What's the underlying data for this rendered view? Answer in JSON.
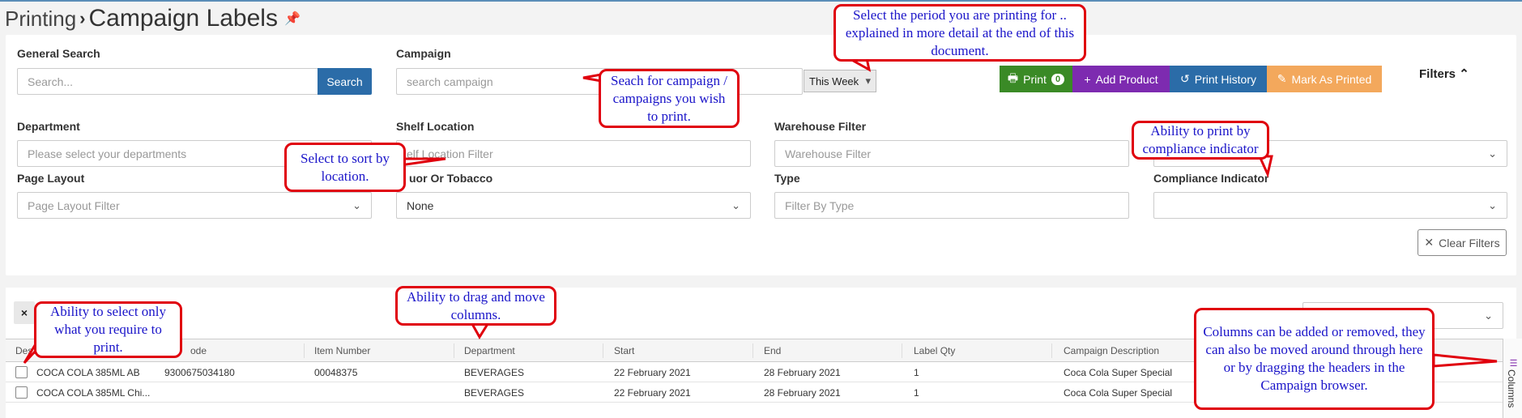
{
  "header": {
    "breadcrumb": "Printing",
    "title": "Campaign Labels",
    "pin_icon": "pin-icon"
  },
  "search": {
    "general_label": "General Search",
    "general_placeholder": "Search...",
    "search_button": "Search",
    "campaign_label": "Campaign",
    "campaign_placeholder": "search campaign",
    "period_value": "This Week"
  },
  "actions": {
    "print": "Print",
    "print_count": "0",
    "add_product": "Add Product",
    "print_history": "Print History",
    "mark_printed": "Mark As Printed",
    "filters": "Filters",
    "colors": {
      "print": "#3a8a26",
      "add": "#7d2bb0",
      "history": "#2b6ca8",
      "mark": "#f3a85c"
    }
  },
  "filters": {
    "department_label": "Department",
    "department_placeholder": "Please select your departments",
    "shelf_label": "Shelf Location",
    "shelf_placeholder": "elf Location Filter",
    "warehouse_label": "Warehouse Filter",
    "warehouse_placeholder": "Warehouse Filter",
    "page_layout_label": "Page Layout",
    "page_layout_placeholder": "Page Layout Filter",
    "liquor_label": "uor Or Tobacco",
    "liquor_value": "None",
    "type_label": "Type",
    "type_placeholder": "Filter By Type",
    "compliance_label": "Compliance Indicator",
    "clear_filters": "Clear Filters"
  },
  "grid": {
    "headers": [
      "Desc",
      "ode",
      "Item Number",
      "Department",
      "Start",
      "End",
      "Label Qty",
      "Campaign Description"
    ],
    "rows": [
      [
        "COCA COLA 385ML AB",
        "9300675034180",
        "00048375",
        "BEVERAGES",
        "22 February 2021",
        "28 February 2021",
        "1",
        "Coca Cola Super Special"
      ],
      [
        "COCA COLA 385ML Chi...",
        "",
        "",
        "BEVERAGES",
        "22 February 2021",
        "28 February 2021",
        "1",
        "Coca Cola Super Special"
      ]
    ],
    "columns_tab": "Columns"
  },
  "callouts": {
    "period": "Select the period you are printing for .. explained in more detail at the end of this document.",
    "campaign": "Seach for campaign / campaigns you wish to print.",
    "location": "Select to sort by location.",
    "compliance": "Ability to print by compliance indicator",
    "select": "Ability to select only what you require to print.",
    "drag": "Ability to drag and move columns.",
    "columns": "Columns can be added or removed, they can also be moved around through here or by dragging the headers in the Campaign browser."
  }
}
